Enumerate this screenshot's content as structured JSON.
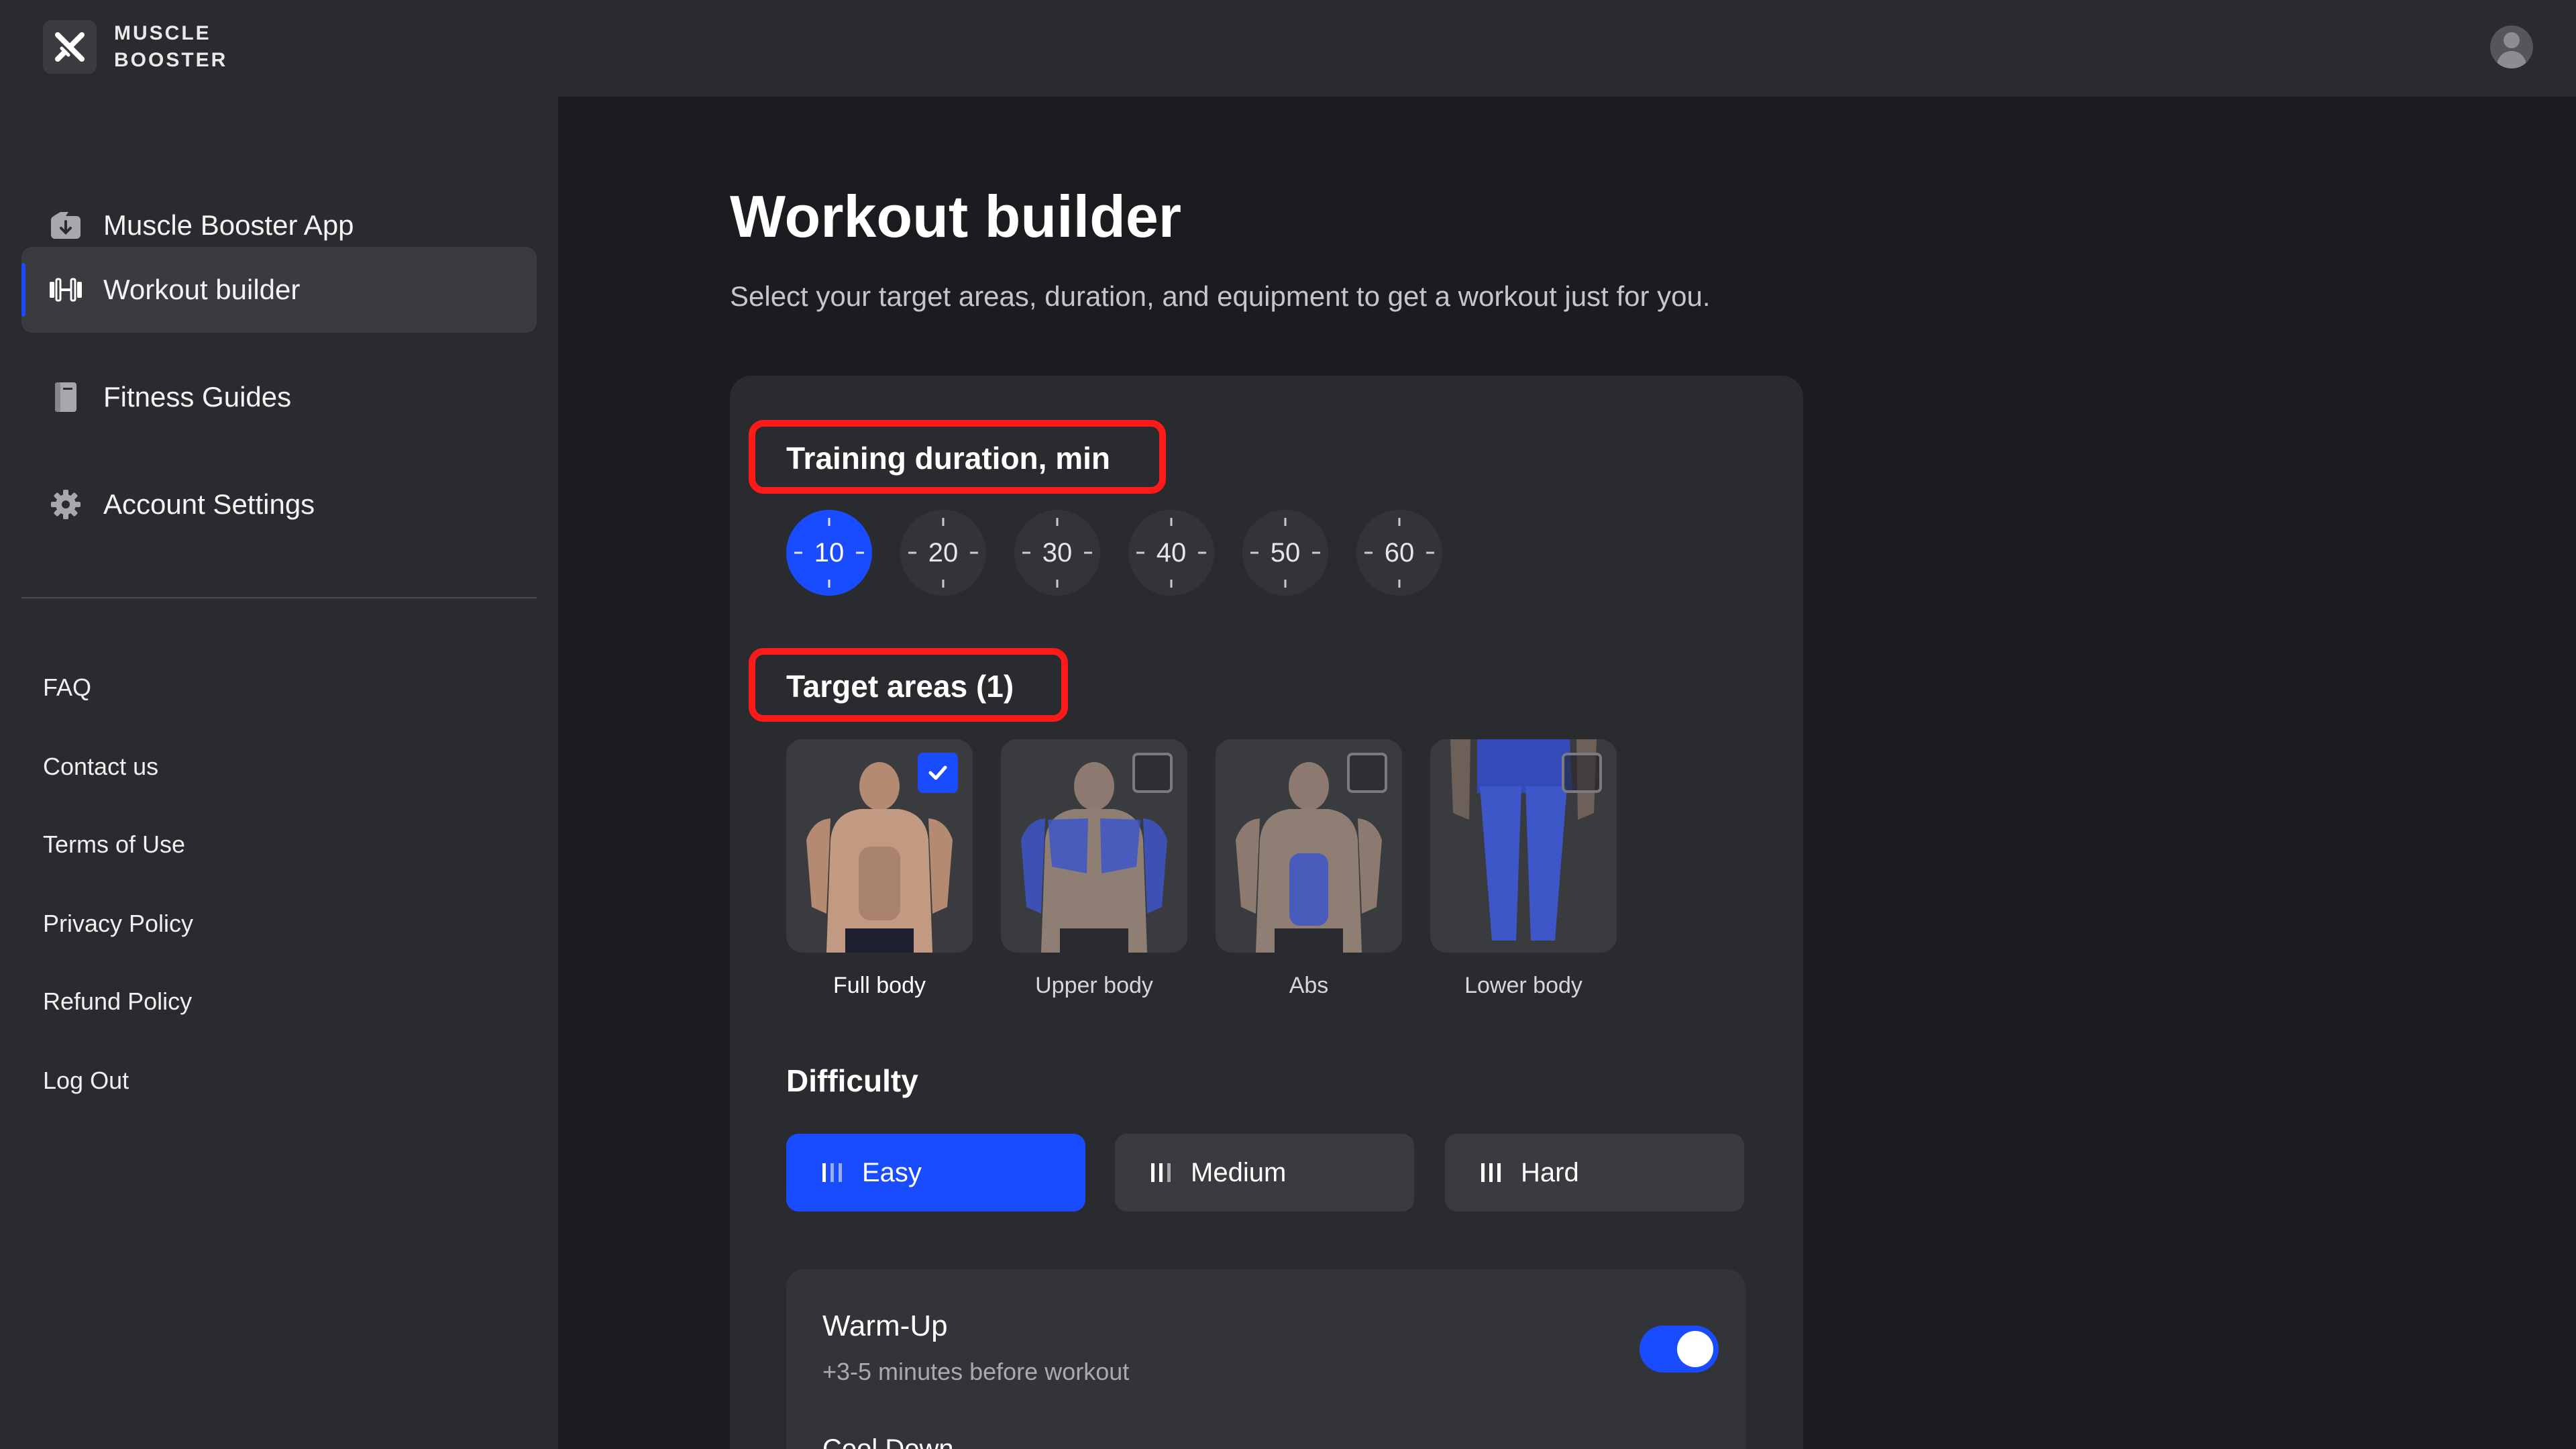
{
  "app": {
    "brand_line1": "MUSCLE",
    "brand_line2": "BOOSTER"
  },
  "sidebar": {
    "items": [
      {
        "label": "Muscle Booster App",
        "icon": "app-download-icon"
      },
      {
        "label": "Workout builder",
        "icon": "dumbbell-icon",
        "active": true
      },
      {
        "label": "Fitness Guides",
        "icon": "book-icon"
      },
      {
        "label": "Account Settings",
        "icon": "gear-icon"
      }
    ],
    "links": [
      "FAQ",
      "Contact us",
      "Terms of Use",
      "Privacy Policy",
      "Refund Policy",
      "Log Out"
    ]
  },
  "main": {
    "title": "Workout builder",
    "subtitle": "Select your target areas, duration, and equipment to get a workout just for you.",
    "duration": {
      "label": "Training duration, min",
      "options": [
        "10",
        "20",
        "30",
        "40",
        "50",
        "60"
      ],
      "selected": "10"
    },
    "target": {
      "label": "Target areas (1)",
      "areas": [
        {
          "label": "Full body",
          "checked": true
        },
        {
          "label": "Upper body",
          "checked": false
        },
        {
          "label": "Abs",
          "checked": false
        },
        {
          "label": "Lower body",
          "checked": false
        }
      ]
    },
    "difficulty": {
      "label": "Difficulty",
      "options": [
        "Easy",
        "Medium",
        "Hard"
      ],
      "selected": "Easy"
    },
    "warmup": {
      "title": "Warm-Up",
      "subtitle": "+3-5 minutes before workout",
      "enabled": true
    },
    "next_section_partial": "Cool Down"
  },
  "colors": {
    "accent": "#1a4cff",
    "highlight": "#ff1a1a",
    "bg": "#1b1c1f",
    "panel": "#2a2b2e"
  }
}
